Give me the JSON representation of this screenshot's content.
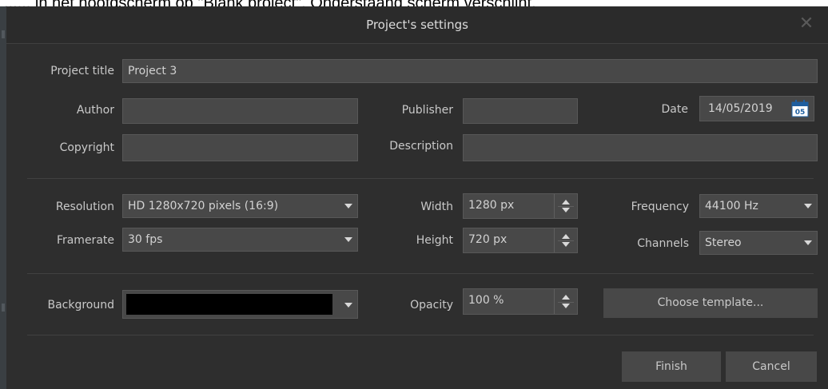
{
  "page_caption": "...... in het hoofdscherm op \"Blank project\". Onderstaand scherm verschijnt.",
  "dialog": {
    "title": "Project's settings",
    "close_icon": "close-icon"
  },
  "general": {
    "project_title_label": "Project title",
    "project_title_value": "Project 3",
    "author_label": "Author",
    "author_value": "",
    "publisher_label": "Publisher",
    "publisher_value": "",
    "date_label": "Date",
    "date_value": "14/05/2019",
    "calendar_icon": "calendar-icon",
    "calendar_day": "05",
    "copyright_label": "Copyright",
    "copyright_value": "",
    "description_label": "Description",
    "description_value": ""
  },
  "video": {
    "resolution_label": "Resolution",
    "resolution_value": "HD 1280x720 pixels (16:9)",
    "framerate_label": "Framerate",
    "framerate_value": "30 fps",
    "width_label": "Width",
    "width_value": "1280 px",
    "height_label": "Height",
    "height_value": "720 px"
  },
  "audio": {
    "frequency_label": "Frequency",
    "frequency_value": "44100 Hz",
    "channels_label": "Channels",
    "channels_value": "Stereo"
  },
  "appearance": {
    "background_label": "Background",
    "background_color": "#000000",
    "opacity_label": "Opacity",
    "opacity_value": "100 %",
    "choose_template_label": "Choose template..."
  },
  "footer": {
    "finish_label": "Finish",
    "cancel_label": "Cancel"
  }
}
